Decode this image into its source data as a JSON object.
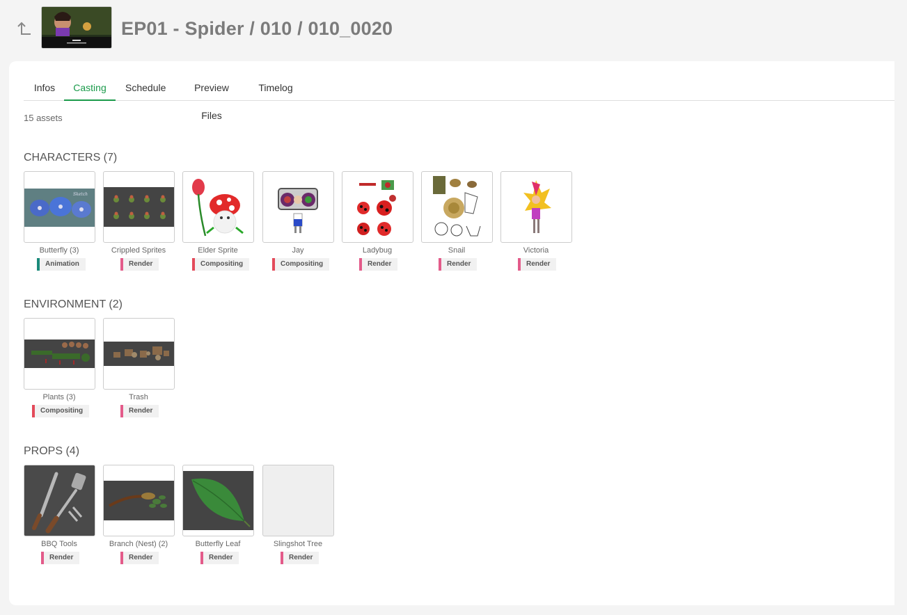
{
  "header": {
    "title": "EP01 - Spider / 010 / 010_0020",
    "back_icon": "back-arrow-icon"
  },
  "tabs": [
    {
      "label": "Infos"
    },
    {
      "label": "Casting"
    },
    {
      "label": "Schedule"
    },
    {
      "label": "Preview Files"
    },
    {
      "label": "Timelog"
    }
  ],
  "active_tab": "Casting",
  "asset_count": "15 assets",
  "status_colors": {
    "Animation": "#1a8a7a",
    "Render": "#e35b8a",
    "Compositing": "#e34a5a"
  },
  "sections": {
    "characters": {
      "title": "CHARACTERS (7)",
      "assets": [
        {
          "name": "Butterfly (3)",
          "status": "Animation"
        },
        {
          "name": "Crippled Sprites",
          "status": "Render"
        },
        {
          "name": "Elder Sprite",
          "status": "Compositing"
        },
        {
          "name": "Jay",
          "status": "Compositing"
        },
        {
          "name": "Ladybug",
          "status": "Render"
        },
        {
          "name": "Snail",
          "status": "Render"
        },
        {
          "name": "Victoria",
          "status": "Render"
        }
      ]
    },
    "environment": {
      "title": "ENVIRONMENT (2)",
      "assets": [
        {
          "name": "Plants (3)",
          "status": "Compositing"
        },
        {
          "name": "Trash",
          "status": "Render"
        }
      ]
    },
    "props": {
      "title": "PROPS (4)",
      "assets": [
        {
          "name": "BBQ Tools",
          "status": "Render"
        },
        {
          "name": "Branch (Nest) (2)",
          "status": "Render"
        },
        {
          "name": "Butterfly Leaf",
          "status": "Render"
        },
        {
          "name": "Slingshot Tree",
          "status": "Render"
        }
      ]
    }
  }
}
